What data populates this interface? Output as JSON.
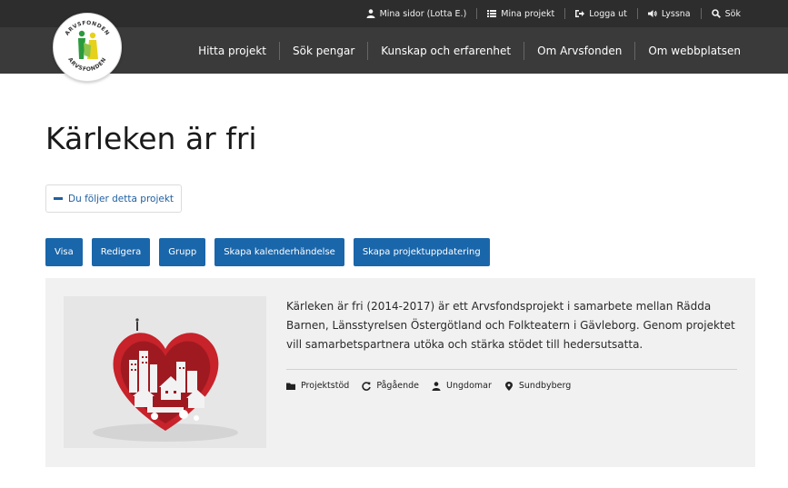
{
  "utility": {
    "items": [
      {
        "label": "Mina sidor (Lotta E.)",
        "icon": "user-icon"
      },
      {
        "label": "Mina projekt",
        "icon": "list-icon"
      },
      {
        "label": "Logga ut",
        "icon": "logout-icon"
      },
      {
        "label": "Lyssna",
        "icon": "speaker-icon"
      },
      {
        "label": "Sök",
        "icon": "search-icon"
      }
    ]
  },
  "logo": {
    "text_top": "ARVSFONDEN",
    "text_bottom": "ARVSFONDEN"
  },
  "nav": {
    "items": [
      "Hitta projekt",
      "Sök pengar",
      "Kunskap och erfarenhet",
      "Om Arvsfonden",
      "Om webbplatsen"
    ]
  },
  "page": {
    "title": "Kärleken är fri",
    "follow_label": "Du följer detta projekt"
  },
  "actions": [
    "Visa",
    "Redigera",
    "Grupp",
    "Skapa kalenderhändelse",
    "Skapa projektuppdatering"
  ],
  "project": {
    "description": "Kärleken är fri (2014-2017) är ett Arvsfondsprojekt i samarbete mellan Rädda Barnen, Länsstyrelsen Östergötland och Folkteatern i Gävleborg. Genom projektet vill samarbetspartnera utöka och stärka stödet till hedersutsatta.",
    "meta": [
      {
        "label": "Projektstöd",
        "icon": "folder-icon"
      },
      {
        "label": "Pågående",
        "icon": "refresh-icon"
      },
      {
        "label": "Ungdomar",
        "icon": "user-icon"
      },
      {
        "label": "Sundbyberg",
        "icon": "location-pin-icon"
      }
    ]
  },
  "colors": {
    "header_top": "#2d2d2d",
    "header_nav": "#3a3a3a",
    "primary": "#1a66aa",
    "card_bg": "#f1f1f1",
    "heart_red": "#c8222a"
  }
}
